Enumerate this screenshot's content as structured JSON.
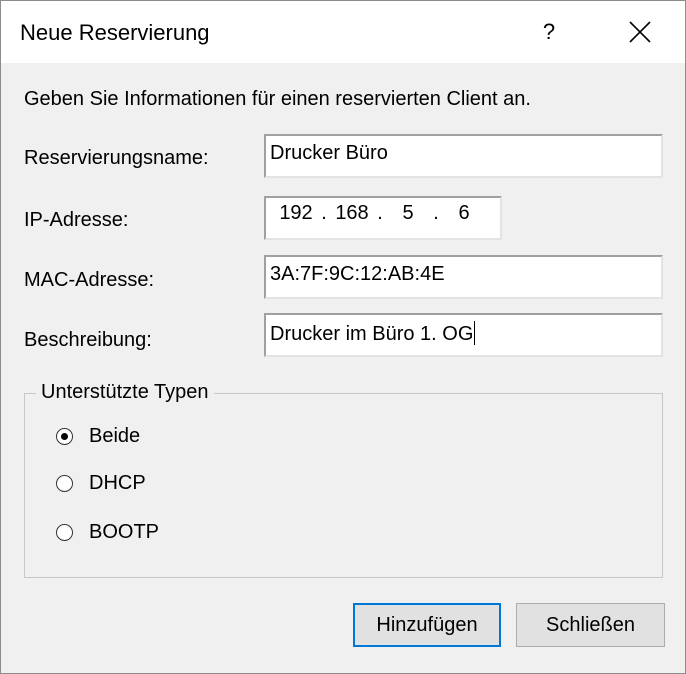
{
  "window": {
    "title": "Neue Reservierung",
    "help_label": "?"
  },
  "instructions": "Geben Sie Informationen für einen reservierten Client an.",
  "form": {
    "name_label": "Reservierungsname:",
    "name_value": "Drucker Büro",
    "ip_label": "IP-Adresse:",
    "ip_octets": [
      "192",
      "168",
      "5",
      "6"
    ],
    "ip_separator": ".",
    "mac_label": "MAC-Adresse:",
    "mac_value": "3A:7F:9C:12:AB:4E",
    "desc_label": "Beschreibung:",
    "desc_value": "Drucker im Büro 1. OG"
  },
  "types": {
    "legend": "Unterstützte Typen",
    "options": [
      {
        "label": "Beide",
        "checked": true
      },
      {
        "label": "DHCP",
        "checked": false
      },
      {
        "label": "BOOTP",
        "checked": false
      }
    ]
  },
  "buttons": {
    "add": "Hinzufügen",
    "close": "Schließen"
  }
}
